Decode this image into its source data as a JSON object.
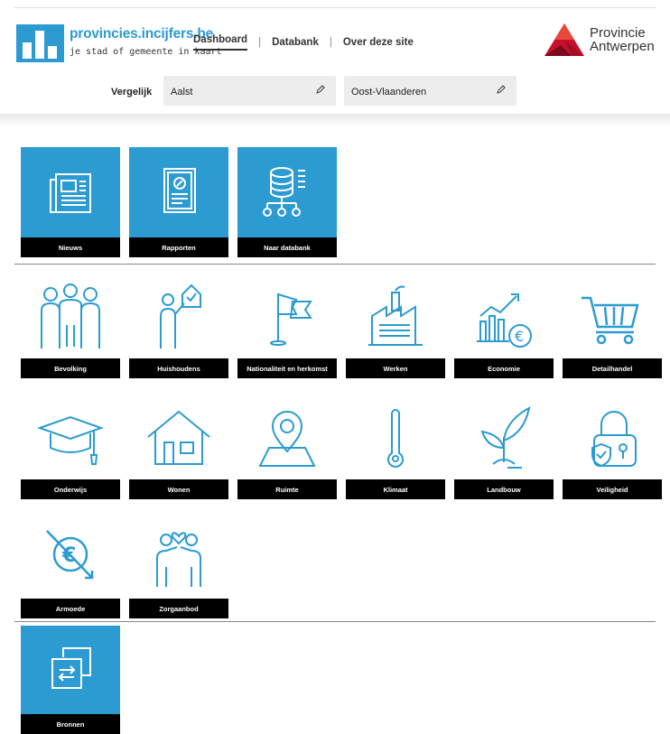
{
  "header": {
    "logo_title": "provincies.incijfers.be",
    "logo_subtitle": "je stad of gemeente in kaart",
    "nav": [
      "Dashboard",
      "Databank",
      "Over deze site"
    ],
    "nav_separator": "|",
    "brand_line1": "Provincie",
    "brand_line2": "Antwerpen"
  },
  "compare": {
    "label": "Vergelijk",
    "field1": "Aalst",
    "field2": "Oost-Vlaanderen"
  },
  "quick_tiles": [
    {
      "label": "Nieuws",
      "icon": "newspaper-icon"
    },
    {
      "label": "Rapporten",
      "icon": "report-icon"
    },
    {
      "label": "Naar databank",
      "icon": "database-icon"
    }
  ],
  "theme_tiles": [
    {
      "label": "Bevolking",
      "icon": "people-icon"
    },
    {
      "label": "Huishoudens",
      "icon": "household-icon"
    },
    {
      "label": "Nationaliteit en herkomst",
      "icon": "flag-icon"
    },
    {
      "label": "Werken",
      "icon": "factory-icon"
    },
    {
      "label": "Economie",
      "icon": "economy-chart-icon"
    },
    {
      "label": "Detailhandel",
      "icon": "shopping-cart-icon"
    },
    {
      "label": "Onderwijs",
      "icon": "graduation-cap-icon"
    },
    {
      "label": "Wonen",
      "icon": "house-icon"
    },
    {
      "label": "Ruimte",
      "icon": "map-pin-icon"
    },
    {
      "label": "Klimaat",
      "icon": "thermometer-icon"
    },
    {
      "label": "Landbouw",
      "icon": "plant-icon"
    },
    {
      "label": "Veiligheid",
      "icon": "padlock-shield-icon"
    },
    {
      "label": "Armoede",
      "icon": "euro-decline-icon"
    },
    {
      "label": "Zorgaanbod",
      "icon": "care-people-icon"
    }
  ],
  "bottom_tiles": [
    {
      "label": "Bronnen",
      "icon": "sources-swap-icon"
    }
  ],
  "colors": {
    "accent": "#2b9bd2",
    "brand_red": "#c8102e"
  }
}
